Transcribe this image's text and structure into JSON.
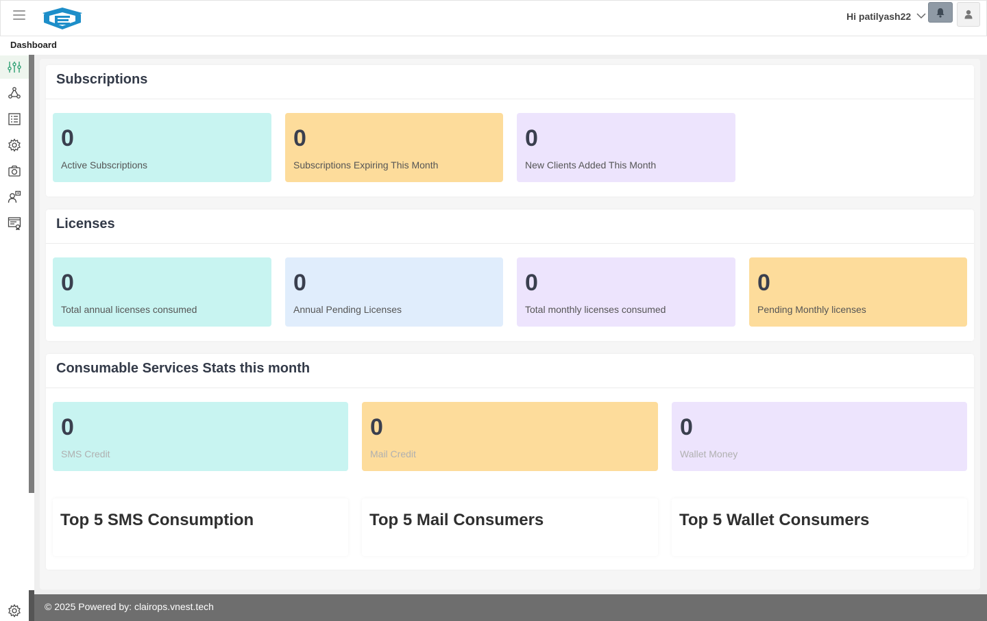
{
  "header": {
    "greeting": "Hi patilyash22",
    "icons": [
      "hamburger-icon",
      "logo",
      "chevron-down-icon",
      "bell-icon",
      "user-icon"
    ]
  },
  "breadcrumb": "Dashboard",
  "sidebar": {
    "items": [
      {
        "icon": "sliders-icon",
        "active": true
      },
      {
        "icon": "network-icon"
      },
      {
        "icon": "list-icon"
      },
      {
        "icon": "gear-icon"
      },
      {
        "icon": "camera-icon"
      },
      {
        "icon": "user-certificate-icon"
      },
      {
        "icon": "billing-icon"
      }
    ]
  },
  "subscriptions": {
    "title": "Subscriptions",
    "cards": [
      {
        "value": "0",
        "label": "Active Subscriptions",
        "color": "#c8f4f1"
      },
      {
        "value": "0",
        "label": "Subscriptions Expiring This Month",
        "color": "#fddc9b"
      },
      {
        "value": "0",
        "label": "New Clients Added This Month",
        "color": "#ede4fd"
      }
    ]
  },
  "licenses": {
    "title": "Licenses",
    "cards": [
      {
        "value": "0",
        "label": "Total annual licenses consumed",
        "color": "#c8f4f1"
      },
      {
        "value": "0",
        "label": "Annual Pending Licenses",
        "color": "#e0edfc"
      },
      {
        "value": "0",
        "label": "Total monthly licenses consumed",
        "color": "#ede4fd"
      },
      {
        "value": "0",
        "label": "Pending Monthly licenses",
        "color": "#fddc9b"
      }
    ]
  },
  "consumables": {
    "title": "Consumable Services Stats this month",
    "cards": [
      {
        "value": "0",
        "label": "SMS Credit",
        "color": "#c8f4f1"
      },
      {
        "value": "0",
        "label": "Mail Credit",
        "color": "#fddc9b"
      },
      {
        "value": "0",
        "label": "Wallet Money",
        "color": "#ede4fd"
      }
    ],
    "top": [
      {
        "title": "Top 5 SMS Consumption"
      },
      {
        "title": "Top 5 Mail Consumers"
      },
      {
        "title": "Top 5 Wallet Consumers"
      }
    ]
  },
  "footer": {
    "text": "© 2025 Powered by: clairops.vnest.tech"
  }
}
